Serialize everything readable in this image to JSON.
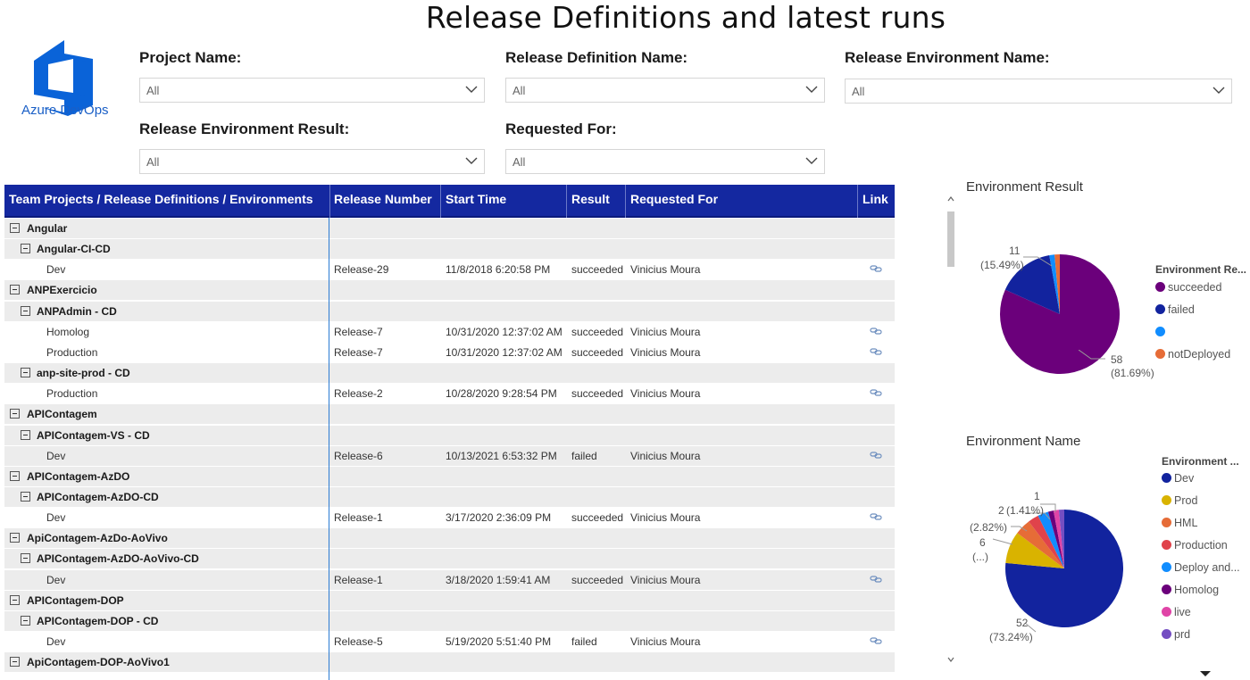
{
  "page_title": "Release Definitions and latest runs",
  "logo_text": "Azure DevOps",
  "filters": {
    "project_name": {
      "label": "Project Name:",
      "value": "All"
    },
    "release_definition_name": {
      "label": "Release Definition Name:",
      "value": "All"
    },
    "release_environment_name": {
      "label": "Release Environment Name:",
      "value": "All"
    },
    "release_environment_result": {
      "label": "Release Environment Result:",
      "value": "All"
    },
    "requested_for": {
      "label": "Requested For:",
      "value": "All"
    }
  },
  "matrix": {
    "headers": [
      "Team Projects / Release Definitions / Environments",
      "Release Number",
      "Start Time",
      "Result",
      "Requested For",
      "Link"
    ],
    "rows": [
      {
        "level": 0,
        "name": "Angular"
      },
      {
        "level": 1,
        "name": "Angular-CI-CD"
      },
      {
        "level": 2,
        "name": "Dev",
        "release": "Release-29",
        "start": "11/8/2018 6:20:58 PM",
        "result": "succeeded",
        "requested_for": "Vinicius Moura"
      },
      {
        "level": 0,
        "name": "ANPExercicio"
      },
      {
        "level": 1,
        "name": "ANPAdmin - CD"
      },
      {
        "level": 2,
        "name": "Homolog",
        "release": "Release-7",
        "start": "10/31/2020 12:37:02 AM",
        "result": "succeeded",
        "requested_for": "Vinicius Moura"
      },
      {
        "level": 2,
        "name": "Production",
        "release": "Release-7",
        "start": "10/31/2020 12:37:02 AM",
        "result": "succeeded",
        "requested_for": "Vinicius Moura"
      },
      {
        "level": 1,
        "name": "anp-site-prod - CD"
      },
      {
        "level": 2,
        "name": "Production",
        "release": "Release-2",
        "start": "10/28/2020 9:28:54 PM",
        "result": "succeeded",
        "requested_for": "Vinicius Moura"
      },
      {
        "level": 0,
        "name": "APIContagem"
      },
      {
        "level": 1,
        "name": "APIContagem-VS - CD"
      },
      {
        "level": 2,
        "name": "Dev",
        "release": "Release-6",
        "start": "10/13/2021 6:53:32 PM",
        "result": "failed",
        "requested_for": "Vinicius Moura"
      },
      {
        "level": 0,
        "name": "APIContagem-AzDO"
      },
      {
        "level": 1,
        "name": "APIContagem-AzDO-CD"
      },
      {
        "level": 2,
        "name": "Dev",
        "release": "Release-1",
        "start": "3/17/2020 2:36:09 PM",
        "result": "succeeded",
        "requested_for": "Vinicius Moura"
      },
      {
        "level": 0,
        "name": "ApiContagem-AzDo-AoVivo"
      },
      {
        "level": 1,
        "name": "APIContagem-AzDO-AoVivo-CD"
      },
      {
        "level": 2,
        "name": "Dev",
        "release": "Release-1",
        "start": "3/18/2020 1:59:41 AM",
        "result": "succeeded",
        "requested_for": "Vinicius Moura"
      },
      {
        "level": 0,
        "name": "APIContagem-DOP"
      },
      {
        "level": 1,
        "name": "APIContagem-DOP - CD"
      },
      {
        "level": 2,
        "name": "Dev",
        "release": "Release-5",
        "start": "5/19/2020 5:51:40 PM",
        "result": "failed",
        "requested_for": "Vinicius Moura"
      },
      {
        "level": 0,
        "name": "ApiContagem-DOP-AoVivo1"
      }
    ]
  },
  "charts": {
    "environment_result": {
      "title": "Environment Result",
      "legend_title": "Environment Re...",
      "labels": [
        {
          "value": "11",
          "pct": "(15.49%)"
        },
        {
          "value": "58",
          "pct": "(81.69%)"
        }
      ]
    },
    "environment_name": {
      "title": "Environment Name",
      "legend_title": "Environment ...",
      "labels": [
        {
          "value": "1"
        },
        {
          "value": "2",
          "pct": "(1.41%)"
        },
        {
          "value": "(2.82%)"
        },
        {
          "value": "6",
          "pct": "(...)"
        },
        {
          "value": "52",
          "pct": "(73.24%)"
        }
      ]
    }
  },
  "chart_data": [
    {
      "type": "pie",
      "title": "Environment Result",
      "legend_title": "Environment Re...",
      "legend_position": "right",
      "categories": [
        "succeeded",
        "failed",
        "",
        "notDeployed"
      ],
      "values": [
        58,
        11,
        1,
        1
      ],
      "colors": [
        "#6b007b",
        "#12239e",
        "#118dff",
        "#e66c37"
      ]
    },
    {
      "type": "pie",
      "title": "Environment Name",
      "legend_title": "Environment ...",
      "legend_position": "right",
      "categories": [
        "Dev",
        "Prod",
        "HML",
        "Production",
        "Deploy and...",
        "Homolog",
        "live",
        "prd"
      ],
      "values": [
        52,
        6,
        3,
        2,
        2,
        1,
        1,
        1
      ],
      "colors": [
        "#12239e",
        "#d9b300",
        "#e66c37",
        "#e0434b",
        "#118dff",
        "#6b007b",
        "#e044a7",
        "#744ec2"
      ]
    }
  ]
}
